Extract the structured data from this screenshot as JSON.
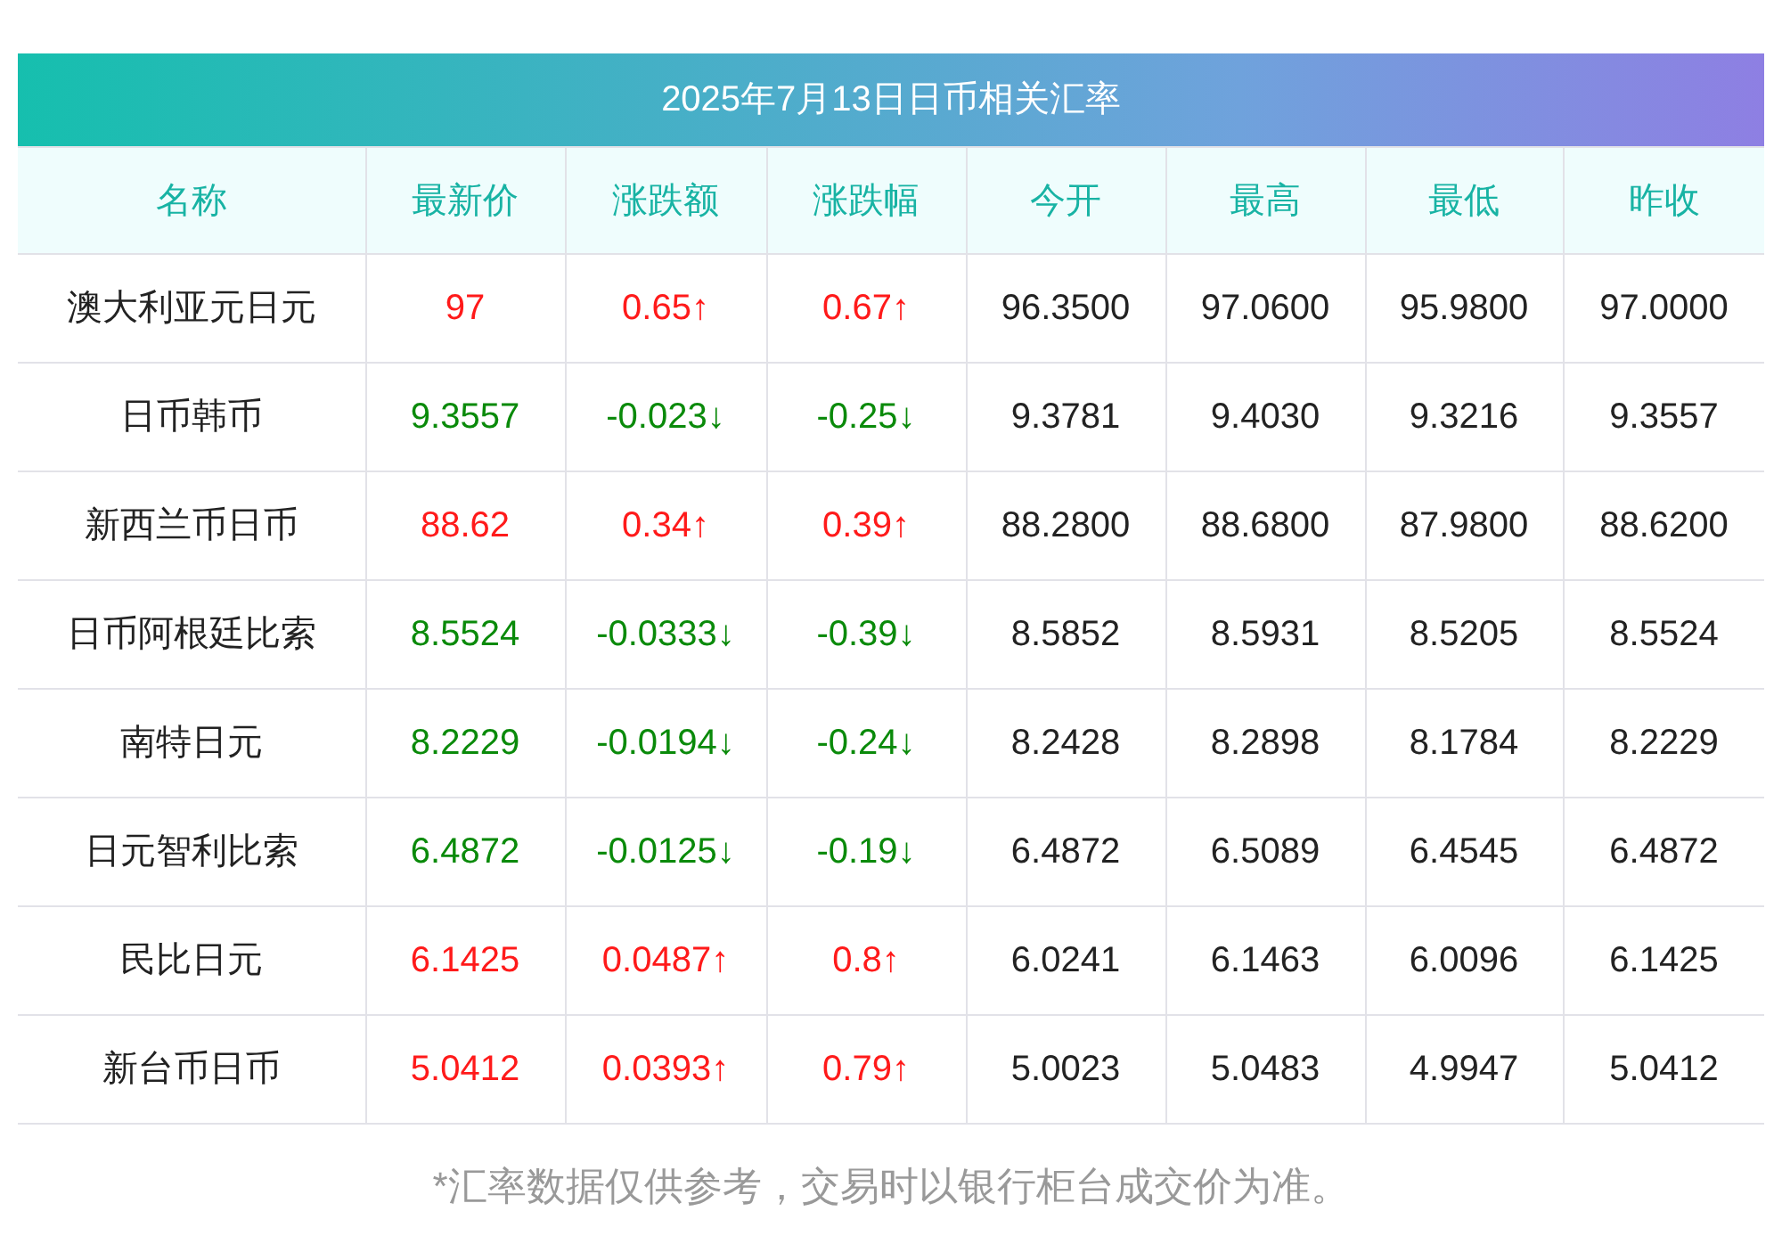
{
  "title": "2025年7月13日日币相关汇率",
  "columns": [
    "名称",
    "最新价",
    "涨跌额",
    "涨跌幅",
    "今开",
    "最高",
    "最低",
    "昨收"
  ],
  "rows": [
    {
      "rising": true,
      "cells": [
        "澳大利亚元日元",
        "97",
        "0.65↑",
        "0.67↑",
        "96.3500",
        "97.0600",
        "95.9800",
        "97.0000"
      ]
    },
    {
      "rising": false,
      "cells": [
        "日币韩币",
        "9.3557",
        "-0.023↓",
        "-0.25↓",
        "9.3781",
        "9.4030",
        "9.3216",
        "9.3557"
      ]
    },
    {
      "rising": true,
      "cells": [
        "新西兰币日币",
        "88.62",
        "0.34↑",
        "0.39↑",
        "88.2800",
        "88.6800",
        "87.9800",
        "88.6200"
      ]
    },
    {
      "rising": false,
      "cells": [
        "日币阿根廷比索",
        "8.5524",
        "-0.0333↓",
        "-0.39↓",
        "8.5852",
        "8.5931",
        "8.5205",
        "8.5524"
      ]
    },
    {
      "rising": false,
      "cells": [
        "南特日元",
        "8.2229",
        "-0.0194↓",
        "-0.24↓",
        "8.2428",
        "8.2898",
        "8.1784",
        "8.2229"
      ]
    },
    {
      "rising": false,
      "cells": [
        "日元智利比索",
        "6.4872",
        "-0.0125↓",
        "-0.19↓",
        "6.4872",
        "6.5089",
        "6.4545",
        "6.4872"
      ]
    },
    {
      "rising": true,
      "cells": [
        "民比日元",
        "6.1425",
        "0.0487↑",
        "0.8↑",
        "6.0241",
        "6.1463",
        "6.0096",
        "6.1425"
      ]
    },
    {
      "rising": true,
      "cells": [
        "新台币日币",
        "5.0412",
        "0.0393↑",
        "0.79↑",
        "5.0023",
        "5.0483",
        "4.9947",
        "5.0412"
      ]
    }
  ],
  "note": "*汇率数据仅供参考，交易时以银行柜台成交价为准。"
}
